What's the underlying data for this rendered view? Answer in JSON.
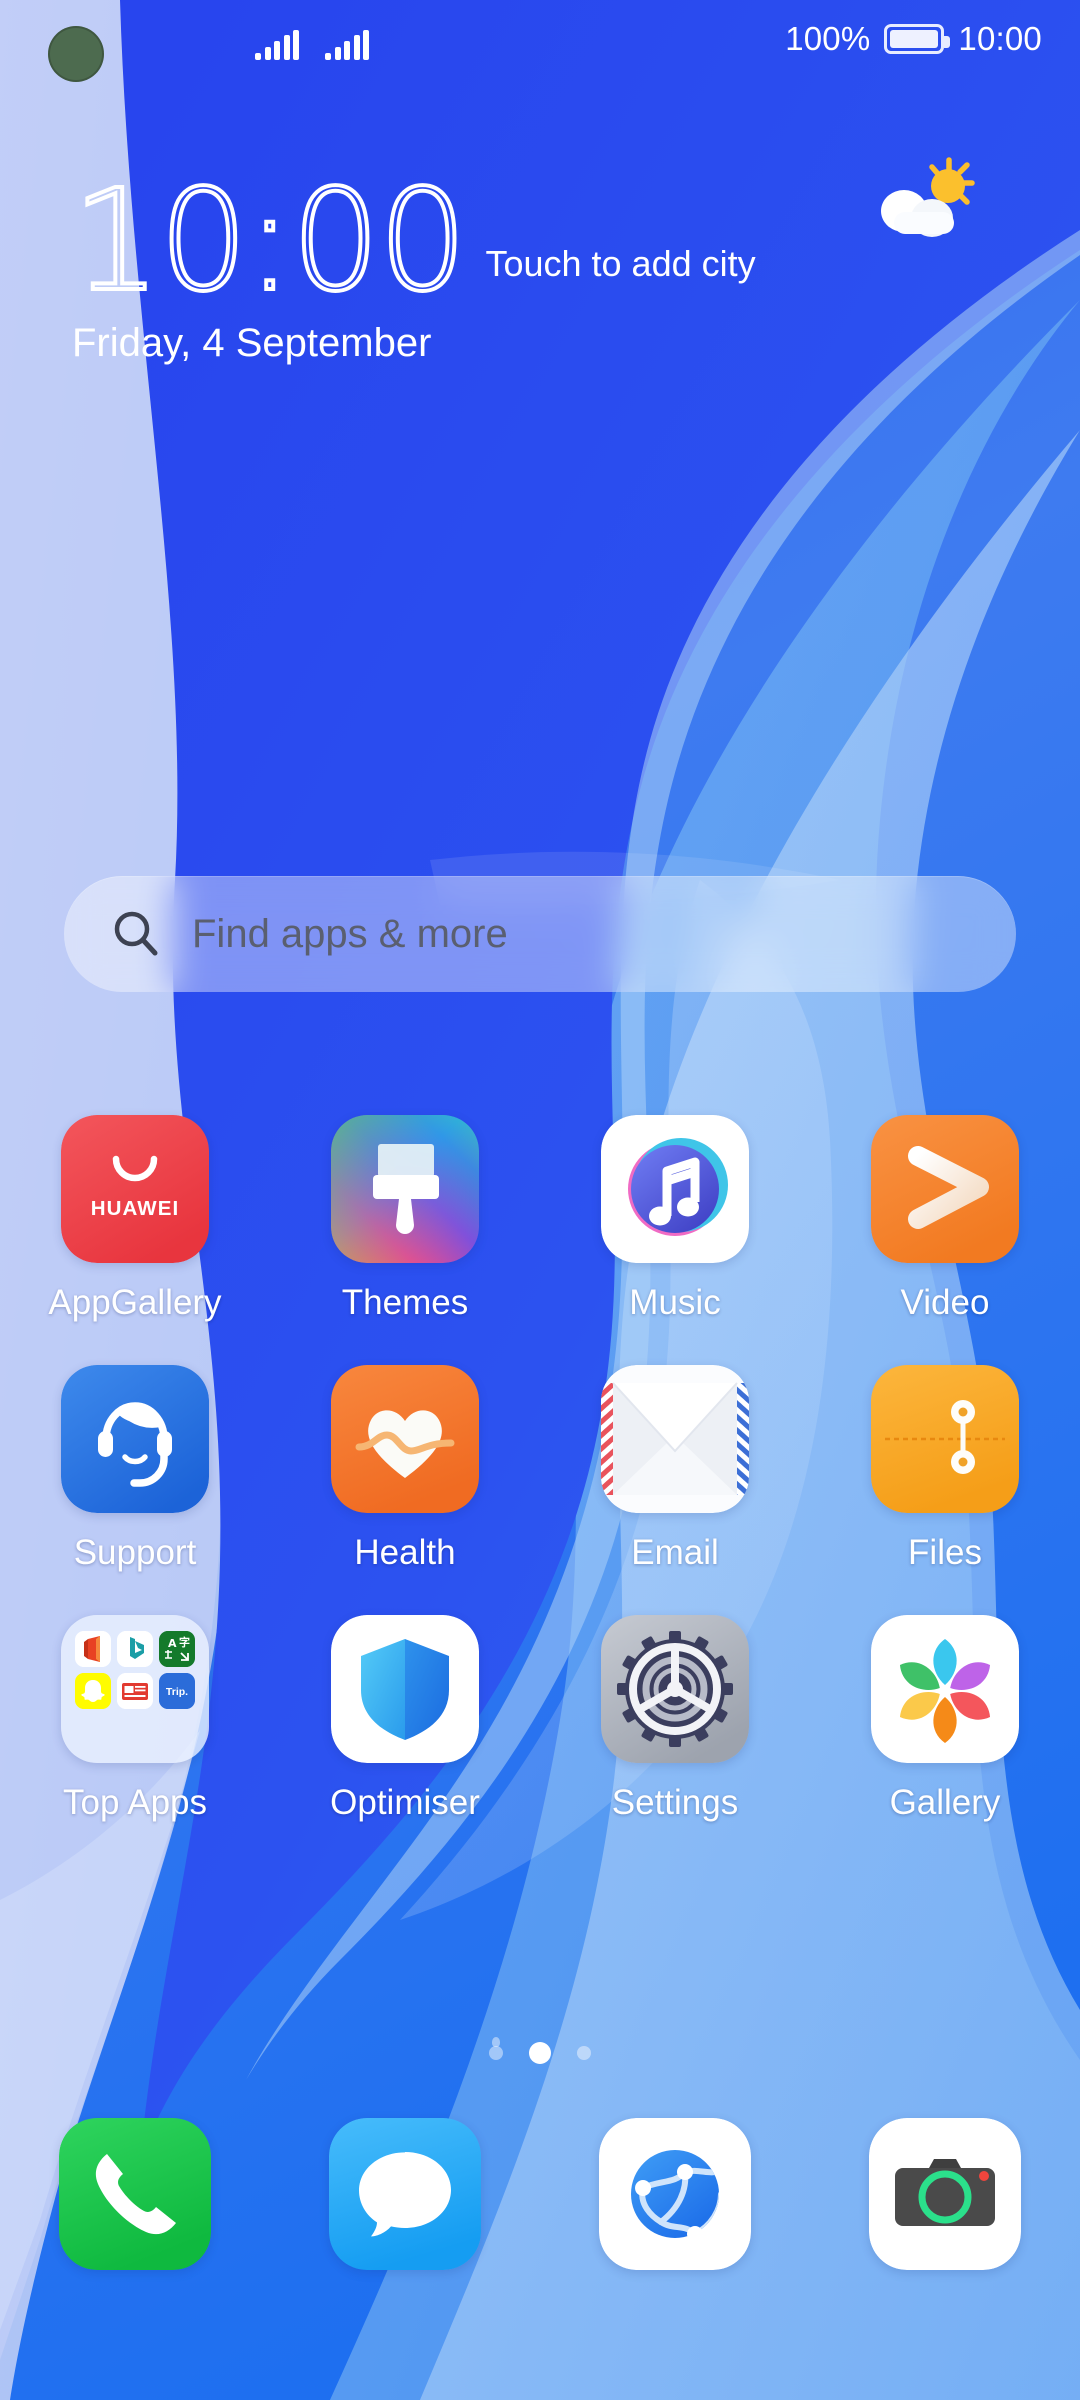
{
  "status_bar": {
    "signal_icons": [
      "signal-bars-sim1",
      "signal-bars-sim2"
    ],
    "battery_percent": "100%",
    "battery_icon": "battery-full-icon",
    "time": "10:00"
  },
  "clock_widget": {
    "time": "10:00",
    "city_hint": "Touch to add city",
    "date": "Friday, 4 September",
    "weather_icon": "sun-behind-cloud-icon"
  },
  "search": {
    "icon": "search-icon",
    "placeholder": "Find apps & more",
    "value": ""
  },
  "grid": {
    "rows": [
      [
        {
          "label": "AppGallery",
          "icon": "appgallery-icon"
        },
        {
          "label": "Themes",
          "icon": "themes-icon"
        },
        {
          "label": "Music",
          "icon": "music-icon"
        },
        {
          "label": "Video",
          "icon": "video-icon"
        }
      ],
      [
        {
          "label": "Support",
          "icon": "support-icon"
        },
        {
          "label": "Health",
          "icon": "health-icon"
        },
        {
          "label": "Email",
          "icon": "email-icon"
        },
        {
          "label": "Files",
          "icon": "files-icon"
        }
      ],
      [
        {
          "label": "Top Apps",
          "icon": "folder-icon"
        },
        {
          "label": "Optimiser",
          "icon": "optimiser-icon"
        },
        {
          "label": "Settings",
          "icon": "settings-icon"
        },
        {
          "label": "Gallery",
          "icon": "gallery-icon"
        }
      ]
    ],
    "folder_apps": [
      {
        "name": "Office",
        "icon": "office-icon"
      },
      {
        "name": "Bing",
        "icon": "bing-icon"
      },
      {
        "name": "Translate",
        "icon": "translate-icon"
      },
      {
        "name": "Snapchat",
        "icon": "snapchat-icon"
      },
      {
        "name": "News",
        "icon": "news-icon"
      },
      {
        "name": "Trip.com",
        "icon": "trip-icon",
        "text": "Trip."
      }
    ]
  },
  "page_indicator": {
    "pages": 3,
    "active_index": 1
  },
  "dock": [
    {
      "label": "Phone",
      "icon": "phone-icon"
    },
    {
      "label": "Messages",
      "icon": "messages-icon"
    },
    {
      "label": "Browser",
      "icon": "browser-icon"
    },
    {
      "label": "Camera",
      "icon": "camera-icon"
    }
  ],
  "colors": {
    "wallpaper_deep_blue": "#2A4FEE",
    "wallpaper_mid_blue": "#3E7BF0",
    "wallpaper_light_blue": "#9FC6F5",
    "wallpaper_pale": "#BFCCF7",
    "appgallery_red": "#F0464B",
    "video_orange": "#F5832E",
    "files_orange": "#FBA82A",
    "health_orange": "#F47B35",
    "support_blue": "#2E7BE0",
    "phone_green": "#1ECA4E",
    "messages_blue": "#2BA7F5",
    "camera_dark": "#4A4A4A",
    "camera_lens_green": "#2BE08B",
    "settings_grey": "#B2B6BE"
  }
}
